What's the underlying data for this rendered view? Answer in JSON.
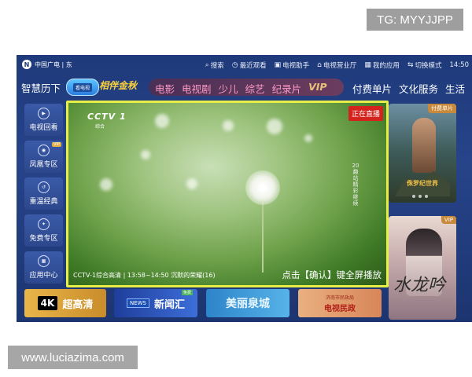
{
  "overlay": {
    "tg_label": "TG: MYYJJPP",
    "watermark": "www.luciazima.com"
  },
  "topbar": {
    "logo_text": "中国广电 | 东",
    "items": [
      {
        "icon": "search-icon",
        "glyph": "⌕",
        "label": "搜索"
      },
      {
        "icon": "clock-icon",
        "glyph": "◷",
        "label": "最近观看"
      },
      {
        "icon": "tv-icon",
        "glyph": "▣",
        "label": "电视助手"
      },
      {
        "icon": "home-icon",
        "glyph": "⌂",
        "label": "电视营业厅"
      },
      {
        "icon": "apps-icon",
        "glyph": "▦",
        "label": "我的应用"
      },
      {
        "icon": "switch-icon",
        "glyph": "⇆",
        "label": "切换模式"
      }
    ],
    "time": "14:50"
  },
  "nav": {
    "brand": "智慧历下",
    "tv_badge": "看电视",
    "promo": "相伴金秋",
    "pill_items": [
      "电影",
      "电视剧",
      "少儿",
      "综艺",
      "纪录片",
      "VIP"
    ],
    "right_items": [
      "付费单片",
      "文化服务",
      "生活"
    ]
  },
  "sidebar": {
    "items": [
      {
        "label": "电视回看",
        "icon": "play-icon",
        "glyph": "▶",
        "tag": ""
      },
      {
        "label": "凤凰专区",
        "icon": "phoenix-icon",
        "glyph": "◉",
        "tag": "VIP"
      },
      {
        "label": "重温经典",
        "icon": "replay-icon",
        "glyph": "↺",
        "tag": ""
      },
      {
        "label": "免费专区",
        "icon": "shield-icon",
        "glyph": "✦",
        "tag": ""
      },
      {
        "label": "应用中心",
        "icon": "grid-icon",
        "glyph": "▦",
        "tag": ""
      }
    ]
  },
  "player": {
    "channel_logo": "CCTV 1",
    "channel_sub": "综合",
    "live_label": "正在直播",
    "side_text": "20 趣站精彩继续",
    "caption": "CCTV-1综合高清 | 13:58~14:50  沉默的荣耀(16)",
    "fullscreen_hint": "点击【确认】键全屏播放"
  },
  "posters": [
    {
      "tag": "付费单片",
      "title": "侏罗纪世界"
    },
    {
      "tag": "VIP",
      "title": "水龙吟"
    }
  ],
  "banners": [
    {
      "badge": "4K",
      "label": "超高清"
    },
    {
      "badge": "NEWS",
      "label": "新闻汇",
      "tag": "免费"
    },
    {
      "label": "美丽泉城"
    },
    {
      "sub": "济南市民政局",
      "label": "电视民政"
    }
  ]
}
